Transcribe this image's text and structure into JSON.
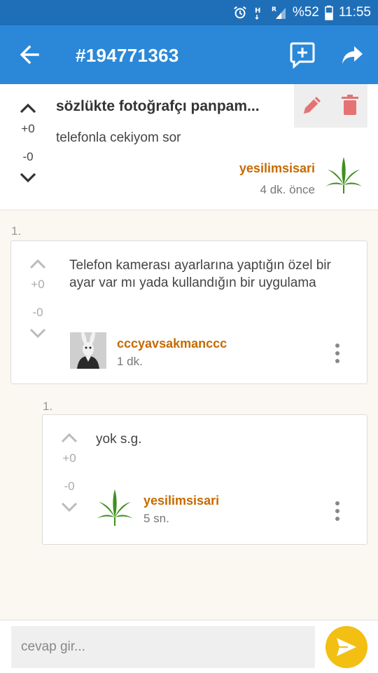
{
  "status_bar": {
    "battery": "%52",
    "time": "11:55"
  },
  "app_bar": {
    "title": "#194771363"
  },
  "post": {
    "title": "sözlükte fotoğrafçı panpam...",
    "body": "telefonla cekiyom sor",
    "upvotes": "+0",
    "downvotes": "-0",
    "author": "yesilimsisari",
    "time": "4 dk. önce"
  },
  "comments": [
    {
      "index": "1.",
      "upvotes": "+0",
      "downvotes": "-0",
      "body": "Telefon kamerası ayarlarına yaptığın özel bir ayar var mı yada kullandığın bir uygulama",
      "author": "cccyavsakmanccc",
      "time": "1 dk.",
      "avatar_icon": "rabbit-mask-photo-icon"
    },
    {
      "index": "1.",
      "upvotes": "+0",
      "downvotes": "-0",
      "body": "yok s.g.",
      "author": "yesilimsisari",
      "time": "5 sn.",
      "avatar_icon": "cannabis-leaf-icon"
    }
  ],
  "reply": {
    "placeholder": "cevap gir..."
  },
  "colors": {
    "app_bar": "#2b88d8",
    "status_bar": "#1f6fb8",
    "author": "#c66a00",
    "send": "#f2bf12",
    "action_red": "#e57373"
  }
}
